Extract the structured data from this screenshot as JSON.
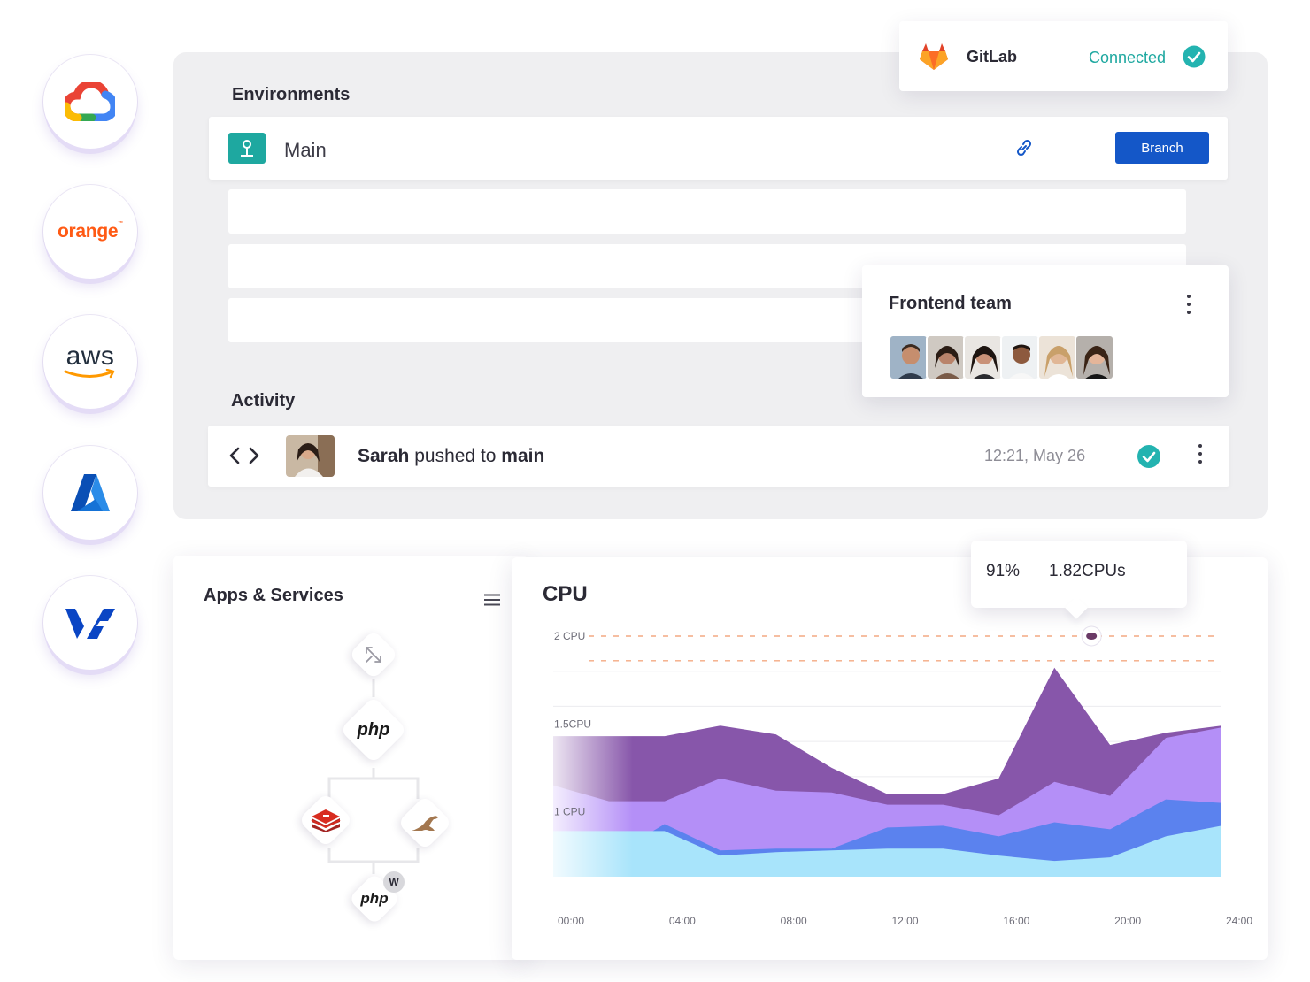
{
  "providers": [
    {
      "name": "google-cloud"
    },
    {
      "name": "orange",
      "label": "orange",
      "tm": "™"
    },
    {
      "name": "aws",
      "label": "aws"
    },
    {
      "name": "azure"
    },
    {
      "name": "ovh"
    }
  ],
  "gitlab": {
    "name": "GitLab",
    "status": "Connected",
    "accent": "#1ea8a0"
  },
  "environments": {
    "title": "Environments",
    "main": {
      "name": "Main",
      "icon": "environment-pin-icon",
      "link_icon": "link-icon",
      "button": "Branch",
      "button_color": "#1457c8"
    }
  },
  "team": {
    "title": "Frontend team",
    "member_count": 6
  },
  "activity": {
    "title": "Activity",
    "item": {
      "user": "Sarah",
      "action": " pushed to ",
      "branch": "main",
      "time": "12:21, May 26",
      "status_icon": "check-circle-icon"
    }
  },
  "apps": {
    "title": "Apps & Services",
    "nodes": [
      {
        "name": "router",
        "icon": "router-arrows-icon"
      },
      {
        "name": "php",
        "label": "php"
      },
      {
        "name": "redis",
        "icon": "redis-icon"
      },
      {
        "name": "mariadb",
        "icon": "seal-icon"
      },
      {
        "name": "php-worker",
        "label": "php",
        "badge": "W"
      }
    ]
  },
  "cpu": {
    "title": "CPU",
    "tooltip": {
      "percent": "91%",
      "cpus": "1.82CPUs"
    }
  },
  "chart_data": {
    "type": "area",
    "title": "CPU",
    "x": [
      "00:00",
      "02:00",
      "04:00",
      "06:00",
      "08:00",
      "10:00",
      "12:00",
      "14:00",
      "16:00",
      "18:00",
      "20:00",
      "22:00",
      "24:00"
    ],
    "x_ticks": [
      "00:00",
      "04:00",
      "08:00",
      "12:00",
      "16:00",
      "20:00",
      "24:00"
    ],
    "y_ticks": [
      {
        "value": 1,
        "label": "1 CPU"
      },
      {
        "value": 1.5,
        "label": "1.5CPU"
      },
      {
        "value": 2,
        "label": "2 CPU"
      }
    ],
    "ylim": [
      0.63,
      2.0
    ],
    "stacked": false,
    "series": [
      {
        "values": [
          0.89,
          0.89,
          0.89,
          0.75,
          0.77,
          0.78,
          0.79,
          0.79,
          0.75,
          0.72,
          0.74,
          0.86,
          0.92
        ],
        "color": "#a8e4fb"
      },
      {
        "values": [
          0.89,
          0.74,
          0.93,
          0.78,
          0.79,
          0.79,
          0.91,
          0.92,
          0.86,
          0.94,
          0.9,
          1.07,
          1.05
        ],
        "color": "#5b82ee"
      },
      {
        "values": [
          1.15,
          1.06,
          1.06,
          1.19,
          1.12,
          1.11,
          1.04,
          1.04,
          0.98,
          1.17,
          1.09,
          1.42,
          1.48
        ],
        "color": "#b48ff7"
      },
      {
        "values": [
          1.43,
          1.43,
          1.43,
          1.49,
          1.44,
          1.25,
          1.1,
          1.1,
          1.19,
          1.82,
          1.38,
          1.45,
          1.49
        ],
        "color": "#8756aa"
      }
    ],
    "highlight": {
      "x": "20:00",
      "value": 2.0
    },
    "reference_lines": [
      2.0,
      1.86
    ],
    "grid": true
  }
}
